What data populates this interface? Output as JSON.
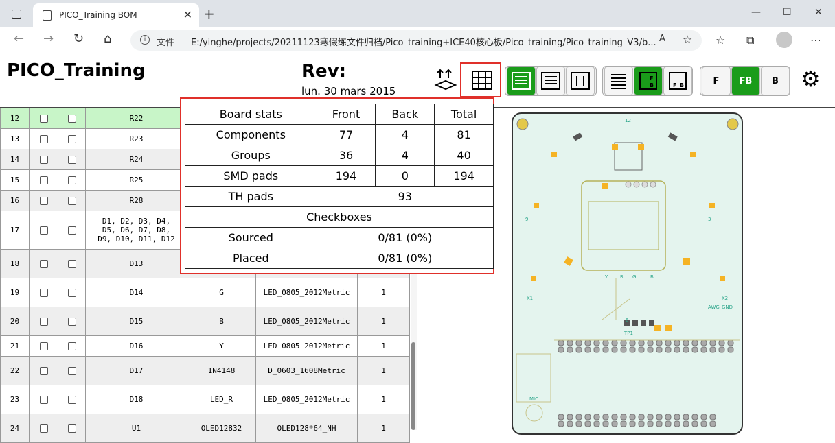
{
  "browser": {
    "tab_title": "PICO_Training BOM",
    "address_prefix": "文件",
    "url": "E:/yinghe/projects/20211123寒假练文件归档/Pico_training+ICE40核心板/Pico_training/Pico_training_V3/b..."
  },
  "header": {
    "title": "PICO_Training",
    "rev_label": "Rev:",
    "date": "lun. 30 mars 2015"
  },
  "buttons": {
    "layer_f": "F",
    "layer_fb": "FB",
    "layer_b": "B"
  },
  "bom_rows": [
    {
      "idx": "12",
      "ref": "R22",
      "val": "",
      "fp": "",
      "qty": ""
    },
    {
      "idx": "13",
      "ref": "R23",
      "val": "",
      "fp": "",
      "qty": ""
    },
    {
      "idx": "14",
      "ref": "R24",
      "val": "",
      "fp": "",
      "qty": ""
    },
    {
      "idx": "15",
      "ref": "R25",
      "val": "",
      "fp": "",
      "qty": ""
    },
    {
      "idx": "16",
      "ref": "R28",
      "val": "",
      "fp": "",
      "qty": ""
    },
    {
      "idx": "17",
      "ref": "D1, D2, D3, D4,\nD5, D6, D7, D8,\nD9, D10, D11, D12",
      "val": "",
      "fp": "",
      "qty": ""
    },
    {
      "idx": "18",
      "ref": "D13",
      "val": "",
      "fp": "",
      "qty": ""
    },
    {
      "idx": "19",
      "ref": "D14",
      "val": "G",
      "fp": "LED_0805_2012Metric",
      "qty": "1"
    },
    {
      "idx": "20",
      "ref": "D15",
      "val": "B",
      "fp": "LED_0805_2012Metric",
      "qty": "1"
    },
    {
      "idx": "21",
      "ref": "D16",
      "val": "Y",
      "fp": "LED_0805_2012Metric",
      "qty": "1"
    },
    {
      "idx": "22",
      "ref": "D17",
      "val": "1N4148",
      "fp": "D_0603_1608Metric",
      "qty": "1"
    },
    {
      "idx": "23",
      "ref": "D18",
      "val": "LED_R",
      "fp": "LED_0805_2012Metric",
      "qty": "1"
    },
    {
      "idx": "24",
      "ref": "U1",
      "val": "OLED12832",
      "fp": "OLED128*64_NH",
      "qty": "1"
    }
  ],
  "stats": {
    "headers": [
      "Board stats",
      "Front",
      "Back",
      "Total"
    ],
    "rows": [
      [
        "Components",
        "77",
        "4",
        "81"
      ],
      [
        "Groups",
        "36",
        "4",
        "40"
      ],
      [
        "SMD pads",
        "194",
        "0",
        "194"
      ]
    ],
    "th_label": "TH pads",
    "th_value": "93",
    "checkboxes_label": "Checkboxes",
    "sourced_label": "Sourced",
    "sourced_value": "0/81 (0%)",
    "placed_label": "Placed",
    "placed_value": "0/81 (0%)"
  },
  "pcb_labels": {
    "top": "12",
    "right": "3",
    "left": "9",
    "bottom": "6",
    "k1": "K1",
    "k2": "K2",
    "awg": "AWG",
    "gnd": "GND",
    "tp1": "TP1",
    "mic": "MIC",
    "y": "Y",
    "r": "R",
    "g": "G",
    "b": "B"
  },
  "colors": {
    "accent_green": "#1a9c1a",
    "highlight_red": "#e0302a",
    "pcb_bg": "#e4f4ee",
    "pad": "#f5b324"
  }
}
